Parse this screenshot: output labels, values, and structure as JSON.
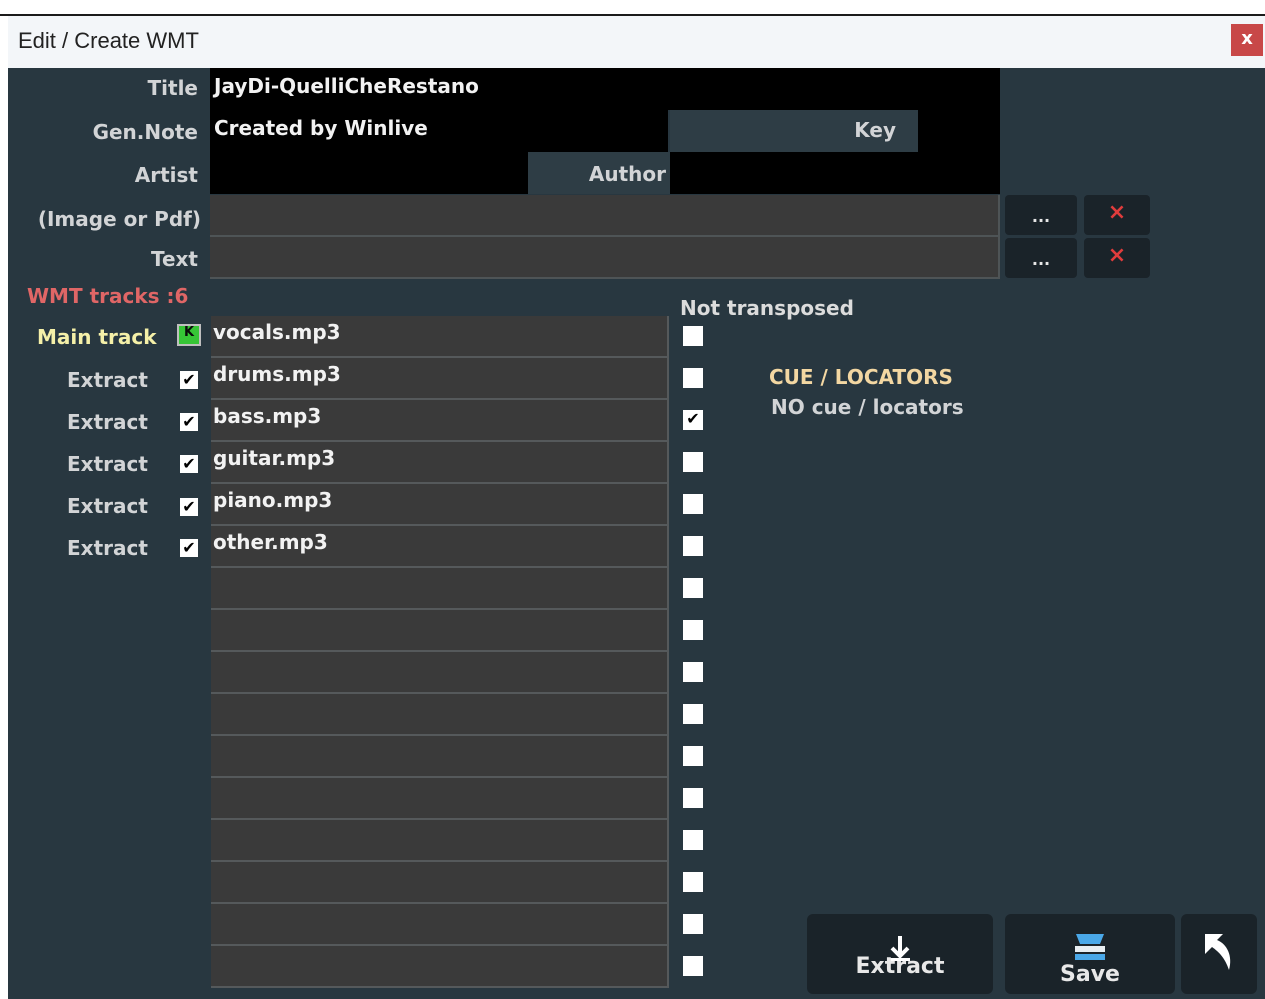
{
  "window": {
    "title": "Edit / Create WMT",
    "close_label": "x"
  },
  "form": {
    "title_label": "Title",
    "title_value": "JayDi-QuelliCheRestano",
    "gennote_label": "Gen.Note",
    "gennote_value": "Created by Winlive",
    "key_label": "Key",
    "key_value": "",
    "artist_label": "Artist",
    "artist_value": "",
    "author_label": "Author",
    "author_value": "",
    "image_label": "(Image or Pdf)",
    "image_value": "",
    "text_label": "Text",
    "text_value": "",
    "browse_label": "...",
    "clear_label": "×"
  },
  "tracks": {
    "count_label": "WMT tracks :6",
    "not_transposed_label": "Not transposed",
    "main_track_label": "Main track",
    "main_marker": "K",
    "rows": [
      {
        "label": "",
        "file": "vocals.mp3",
        "extract": true,
        "not_transposed": false
      },
      {
        "label": "Extract",
        "file": "drums.mp3",
        "extract": true,
        "not_transposed": false
      },
      {
        "label": "Extract",
        "file": "bass.mp3",
        "extract": true,
        "not_transposed": true
      },
      {
        "label": "Extract",
        "file": "guitar.mp3",
        "extract": true,
        "not_transposed": false
      },
      {
        "label": "Extract",
        "file": "piano.mp3",
        "extract": true,
        "not_transposed": false
      },
      {
        "label": "Extract",
        "file": "other.mp3",
        "extract": true,
        "not_transposed": false
      },
      {
        "label": "",
        "file": "",
        "extract": false,
        "not_transposed": false
      },
      {
        "label": "",
        "file": "",
        "extract": false,
        "not_transposed": false
      },
      {
        "label": "",
        "file": "",
        "extract": false,
        "not_transposed": false
      },
      {
        "label": "",
        "file": "",
        "extract": false,
        "not_transposed": false
      },
      {
        "label": "",
        "file": "",
        "extract": false,
        "not_transposed": false
      },
      {
        "label": "",
        "file": "",
        "extract": false,
        "not_transposed": false
      },
      {
        "label": "",
        "file": "",
        "extract": false,
        "not_transposed": false
      },
      {
        "label": "",
        "file": "",
        "extract": false,
        "not_transposed": false
      },
      {
        "label": "",
        "file": "",
        "extract": false,
        "not_transposed": false
      },
      {
        "label": "",
        "file": "",
        "extract": false,
        "not_transposed": false
      }
    ]
  },
  "cue": {
    "title": "CUE / LOCATORS",
    "status": "NO cue / locators"
  },
  "buttons": {
    "extract_label": "Extract",
    "save_label": "Save"
  },
  "colors": {
    "panel_bg": "#283740",
    "accent_red": "#e06666",
    "main_label": "#f5f0a8",
    "cue_title": "#f3d7a2"
  },
  "icons": {
    "extract": "arrow-down-icon",
    "save": "save-icon",
    "back": "back-arrow-icon"
  }
}
